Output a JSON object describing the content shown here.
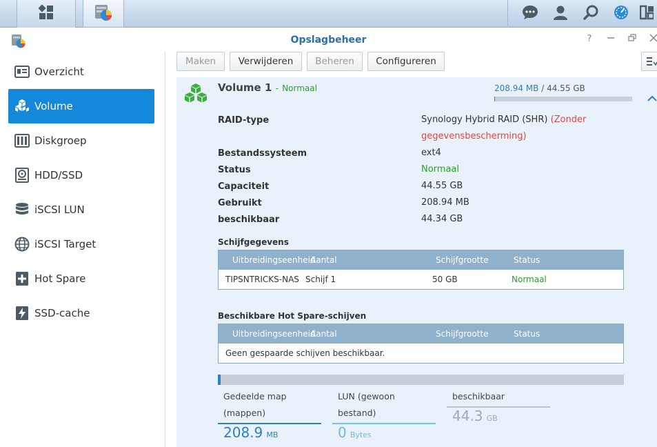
{
  "window": {
    "title": "Opslagbeheer"
  },
  "taskbar": {
    "icons": [
      "grid-icon",
      "storage-manager-icon",
      "chat-icon",
      "user-icon",
      "search-icon",
      "dsm-options-icon",
      "widgets-icon"
    ]
  },
  "sidebar": {
    "items": [
      {
        "label": "Overzicht",
        "icon": "overview-icon"
      },
      {
        "label": "Volume",
        "icon": "volume-icon"
      },
      {
        "label": "Diskgroep",
        "icon": "diskgroup-icon"
      },
      {
        "label": "HDD/SSD",
        "icon": "hdd-icon"
      },
      {
        "label": "iSCSI LUN",
        "icon": "lun-icon"
      },
      {
        "label": "iSCSI Target",
        "icon": "target-icon"
      },
      {
        "label": "Hot Spare",
        "icon": "hot-spare-icon"
      },
      {
        "label": "SSD-cache",
        "icon": "ssd-cache-icon"
      }
    ],
    "active": "Volume"
  },
  "toolbar": {
    "create": "Maken",
    "remove": "Verwijderen",
    "manage": "Beheren",
    "configure": "Configureren"
  },
  "volume": {
    "name": "Volume 1",
    "status_prefix": "-",
    "status": "Normaal",
    "used": "208.94 MB",
    "separator": "/",
    "total": "44.55 GB",
    "usage_fraction": 0.005
  },
  "info": {
    "raid_label": "RAID-type",
    "raid_value": "Synology Hybrid RAID (SHR)",
    "raid_note": "(Zonder gegevensbescherming)",
    "fs_label": "Bestandssysteem",
    "fs_value": "ext4",
    "status_label": "Status",
    "status_value": "Normaal",
    "capacity_label": "Capaciteit",
    "capacity_value": "44.55 GB",
    "used_label": "Gebruikt",
    "used_value": "208.94 MB",
    "available_label": "beschikbaar",
    "available_value": "44.34 GB"
  },
  "disks": {
    "title": "Schijfgegevens",
    "headers": [
      "Uitbreidingseenheid",
      "Aantal",
      "Schijfgrootte",
      "Status"
    ],
    "rows": [
      {
        "unit": "TIPSNTRICKS-NAS",
        "count": "Schijf 1",
        "size": "50 GB",
        "status": "Normaal"
      }
    ]
  },
  "hotspare": {
    "title": "Beschikbare Hot Spare-schijven",
    "headers": [
      "Uitbreidingseenheid",
      "Aantal",
      "Schijfgrootte",
      "Status"
    ],
    "empty": "Geen gespaarde schijven beschikbaar."
  },
  "stats": {
    "shared_label": "Gedeelde map (mappen)",
    "shared_value": "208.9",
    "shared_unit": "MB",
    "lun_label": "LUN (gewoon bestand)",
    "lun_value": "0",
    "lun_unit": "Bytes",
    "avail_label": "beschikbaar",
    "avail_value": "44.3",
    "avail_unit": "GB"
  },
  "colors": {
    "accent": "#1488db",
    "title": "#2d6fa8",
    "normal": "#2c9e2c",
    "warning": "#e04848",
    "volume_icon": "#3fae3f"
  }
}
